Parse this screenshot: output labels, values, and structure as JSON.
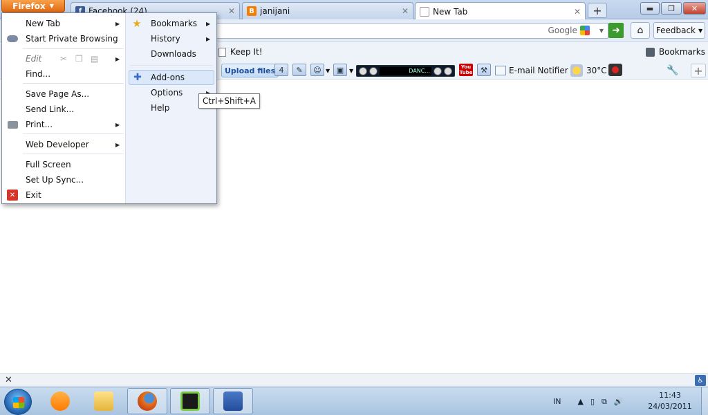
{
  "browser": {
    "app_button": "Firefox",
    "tabs": [
      {
        "title": "Facebook (24)",
        "icon": "facebook-icon",
        "color": "#3b5998"
      },
      {
        "title": "janijani",
        "icon": "blogger-icon",
        "color": "#f57d00"
      },
      {
        "title": "New Tab",
        "icon": "page-icon",
        "active": true
      }
    ]
  },
  "navbar": {
    "search_engine": "Google",
    "feedback_label": "Feedback"
  },
  "bookmarks_bar": {
    "keep_it": "Keep It!",
    "bookmarks_label": "Bookmarks"
  },
  "toolbar": {
    "upload_label": "Upload files",
    "player_text": "DANC...",
    "email_notifier": "E-mail Notifier",
    "temperature": "30°C"
  },
  "ff_menu": {
    "left_items": [
      "New Tab",
      "Start Private Browsing",
      "Edit",
      "Find...",
      "Save Page As...",
      "Send Link...",
      "Print...",
      "Web Developer",
      "Full Screen",
      "Set Up Sync...",
      "Exit"
    ],
    "right_items": [
      "Bookmarks",
      "History",
      "Downloads",
      "Add-ons",
      "Options",
      "Help"
    ],
    "tooltip": "Ctrl+Shift+A"
  },
  "taskbar": {
    "language": "IN",
    "time": "11:43",
    "date": "24/03/2011"
  },
  "colors": {
    "firefox_orange": "#e06a12",
    "taskbar_blue": "#a9c4e0",
    "menu_highlight": "#dbe8f9"
  }
}
